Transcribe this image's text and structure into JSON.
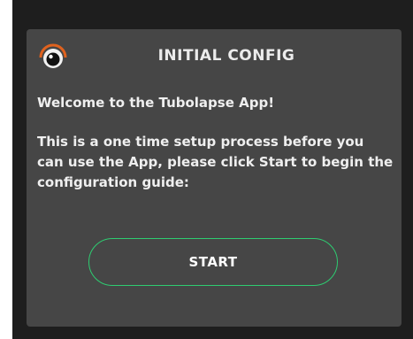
{
  "dialog": {
    "title": "INITIAL CONFIG",
    "logo_icon": "eye-logo-icon",
    "welcome_text": "Welcome to the Tubolapse App!",
    "body_text": "This is a one time setup process before you can use the App, please click Start to begin the configuration guide:",
    "start_label": "START"
  },
  "colors": {
    "background": "#1e1e1e",
    "dialog_background": "#464646",
    "accent_green": "#2ecc71",
    "logo_orange": "#e0621e",
    "text": "#efefef"
  }
}
